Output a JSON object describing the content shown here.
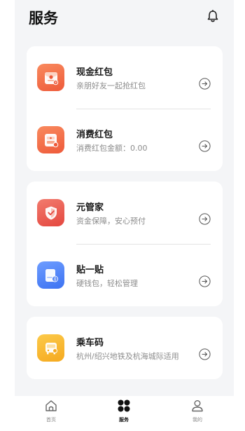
{
  "header": {
    "title": "服务",
    "bell_icon": "bell-icon"
  },
  "colors": {
    "orange": "#ee5a3a",
    "red": "#e4473f",
    "blue": "#3c72f2",
    "yellow": "#f5a91f",
    "background": "#f4f5f7"
  },
  "services": [
    {
      "name": "现金红包",
      "desc": "亲朋好友一起抢红包",
      "icon": "cash-red-packet-icon"
    },
    {
      "name": "消费红包",
      "desc": "消费红包金额：0.00",
      "icon": "consumption-red-packet-icon"
    },
    {
      "name": "元管家",
      "desc": "资金保障，安心预付",
      "icon": "shield-check-icon"
    },
    {
      "name": "贴一贴",
      "desc": "硬钱包，轻松管理",
      "icon": "card-tap-icon"
    },
    {
      "name": "乘车码",
      "desc": "杭州/绍兴地铁及杭海城际适用",
      "icon": "bus-icon"
    }
  ],
  "tabbar": {
    "items": [
      {
        "label": "首页",
        "icon": "home-icon",
        "active": false
      },
      {
        "label": "服务",
        "icon": "grid-icon",
        "active": true
      },
      {
        "label": "我的",
        "icon": "user-icon",
        "active": false
      }
    ]
  }
}
